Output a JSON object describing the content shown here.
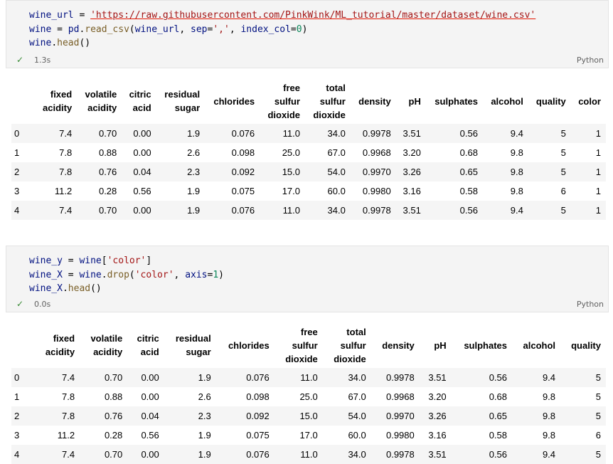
{
  "cells": [
    {
      "code": {
        "l1_var": "wine_url",
        "l1_eq": " = ",
        "l1_str": "'https://raw.githubusercontent.com/PinkWink/ML_tutorial/master/dataset/wine.csv'",
        "l2_var": "wine",
        "l2_eq": " = ",
        "l2_pd": "pd",
        "l2_dot": ".",
        "l2_fn": "read_csv",
        "l2_open": "(",
        "l2_arg": "wine_url",
        "l2_sep": ", ",
        "l2_kw1": "sep",
        "l2_eq2": "=",
        "l2_str": "','",
        "l2_comma": ", ",
        "l2_kw2": "index_col",
        "l2_eq3": "=",
        "l2_num": "0",
        "l2_close": ")",
        "l3_var": "wine",
        "l3_dot": ".",
        "l3_fn": "head",
        "l3_paren": "()"
      },
      "status": {
        "check": "✓",
        "time": "1.3s",
        "language": "Python"
      },
      "table": {
        "headers": [
          [
            "fixed",
            "acidity"
          ],
          [
            "volatile",
            "acidity"
          ],
          [
            "citric",
            "acid"
          ],
          [
            "residual",
            "sugar"
          ],
          [
            "chlorides"
          ],
          [
            "free",
            "sulfur",
            "dioxide"
          ],
          [
            "total",
            "sulfur",
            "dioxide"
          ],
          [
            "density"
          ],
          [
            "pH"
          ],
          [
            "sulphates"
          ],
          [
            "alcohol"
          ],
          [
            "quality"
          ],
          [
            "color"
          ]
        ],
        "rows": [
          [
            "0",
            "7.4",
            "0.70",
            "0.00",
            "1.9",
            "0.076",
            "11.0",
            "34.0",
            "0.9978",
            "3.51",
            "0.56",
            "9.4",
            "5",
            "1"
          ],
          [
            "1",
            "7.8",
            "0.88",
            "0.00",
            "2.6",
            "0.098",
            "25.0",
            "67.0",
            "0.9968",
            "3.20",
            "0.68",
            "9.8",
            "5",
            "1"
          ],
          [
            "2",
            "7.8",
            "0.76",
            "0.04",
            "2.3",
            "0.092",
            "15.0",
            "54.0",
            "0.9970",
            "3.26",
            "0.65",
            "9.8",
            "5",
            "1"
          ],
          [
            "3",
            "11.2",
            "0.28",
            "0.56",
            "1.9",
            "0.075",
            "17.0",
            "60.0",
            "0.9980",
            "3.16",
            "0.58",
            "9.8",
            "6",
            "1"
          ],
          [
            "4",
            "7.4",
            "0.70",
            "0.00",
            "1.9",
            "0.076",
            "11.0",
            "34.0",
            "0.9978",
            "3.51",
            "0.56",
            "9.4",
            "5",
            "1"
          ]
        ]
      }
    },
    {
      "code": {
        "l1_var": "wine_y",
        "l1_eq": " = ",
        "l1_obj": "wine",
        "l1_open": "[",
        "l1_str": "'color'",
        "l1_close": "]",
        "l2_var": "wine_X",
        "l2_eq": " = ",
        "l2_obj": "wine",
        "l2_dot": ".",
        "l2_fn": "drop",
        "l2_open": "(",
        "l2_str": "'color'",
        "l2_comma": ", ",
        "l2_kw": "axis",
        "l2_eq2": "=",
        "l2_num": "1",
        "l2_close": ")",
        "l3_var": "wine_X",
        "l3_dot": ".",
        "l3_fn": "head",
        "l3_paren": "()"
      },
      "status": {
        "check": "✓",
        "time": "0.0s",
        "language": "Python"
      },
      "table": {
        "headers": [
          [
            "fixed",
            "acidity"
          ],
          [
            "volatile",
            "acidity"
          ],
          [
            "citric",
            "acid"
          ],
          [
            "residual",
            "sugar"
          ],
          [
            "chlorides"
          ],
          [
            "free",
            "sulfur",
            "dioxide"
          ],
          [
            "total",
            "sulfur",
            "dioxide"
          ],
          [
            "density"
          ],
          [
            "pH"
          ],
          [
            "sulphates"
          ],
          [
            "alcohol"
          ],
          [
            "quality"
          ]
        ],
        "rows": [
          [
            "0",
            "7.4",
            "0.70",
            "0.00",
            "1.9",
            "0.076",
            "11.0",
            "34.0",
            "0.9978",
            "3.51",
            "0.56",
            "9.4",
            "5"
          ],
          [
            "1",
            "7.8",
            "0.88",
            "0.00",
            "2.6",
            "0.098",
            "25.0",
            "67.0",
            "0.9968",
            "3.20",
            "0.68",
            "9.8",
            "5"
          ],
          [
            "2",
            "7.8",
            "0.76",
            "0.04",
            "2.3",
            "0.092",
            "15.0",
            "54.0",
            "0.9970",
            "3.26",
            "0.65",
            "9.8",
            "5"
          ],
          [
            "3",
            "11.2",
            "0.28",
            "0.56",
            "1.9",
            "0.075",
            "17.0",
            "60.0",
            "0.9980",
            "3.16",
            "0.58",
            "9.8",
            "6"
          ],
          [
            "4",
            "7.4",
            "0.70",
            "0.00",
            "1.9",
            "0.076",
            "11.0",
            "34.0",
            "0.9978",
            "3.51",
            "0.56",
            "9.4",
            "5"
          ]
        ]
      }
    }
  ]
}
